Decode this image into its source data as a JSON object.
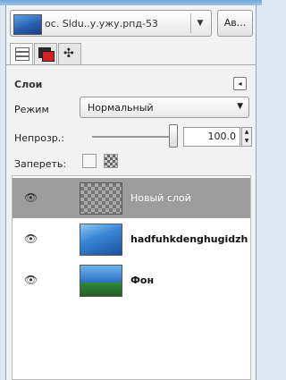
{
  "window": {
    "accent_color": "#6fa8dc"
  },
  "image_selector": {
    "label": "ос. Sldu..у.ужу.рпд-53",
    "arrow_icon": "chevron-down-icon"
  },
  "auto_button": {
    "label": "Ав..."
  },
  "tabs": [
    {
      "icon": "layers-icon",
      "active": true
    },
    {
      "icon": "channels-icon",
      "active": false
    },
    {
      "icon": "paths-icon",
      "active": false
    }
  ],
  "section": {
    "title": "Слои"
  },
  "mode": {
    "label": "Режим",
    "value": "Нормальный"
  },
  "opacity": {
    "label": "Непрозр.:",
    "value": "100.0"
  },
  "lock": {
    "label": "Запереть:"
  },
  "layers": [
    {
      "name": "Новый слой",
      "selected": true,
      "thumb": "transparent"
    },
    {
      "name": "hadfuhkdenghugidzh",
      "selected": false,
      "thumb": "blue"
    },
    {
      "name": "Фон",
      "selected": false,
      "thumb": "sky"
    }
  ]
}
